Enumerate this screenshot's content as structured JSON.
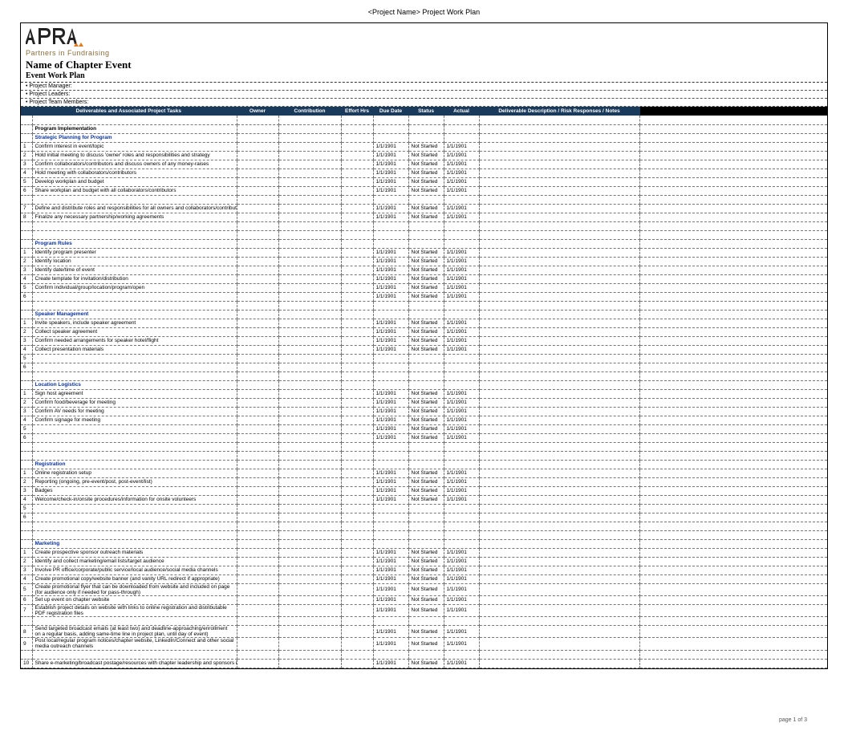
{
  "doc_header": "<Project Name>  Project Work Plan",
  "logo_tagline": "Partners in Fundraising",
  "title": "Name of Chapter Event",
  "subtitle": "Event Work Plan",
  "info": {
    "pm": "Project Manager:",
    "pl": "Project Leaders:",
    "ptm": "Project Team Members:"
  },
  "columns": {
    "task": "Deliverables and Associated Project Tasks",
    "owner": "Owner",
    "contrib": "Contribution",
    "effort": "Effort Hrs",
    "due": "Due Date",
    "status": "Status",
    "actual": "Actual",
    "desc": "Deliverable Description / Risk Responses / Notes"
  },
  "defaults": {
    "date": "1/1/1901",
    "status": "Not Started"
  },
  "sections": [
    {
      "label": "Program Implementation",
      "class": "sec-black",
      "rows": []
    },
    {
      "label": "Strategic Planning for Program",
      "class": "sec-blue",
      "rows": [
        {
          "n": "1",
          "task": "Confirm interest in event/topic",
          "std": true
        },
        {
          "n": "2",
          "task": "Hold initial meeting to discuss 'owner' roles and responsibilities and strategy",
          "std": true
        },
        {
          "n": "3",
          "task": "Confirm collaborators/contributors and discuss owners of any money-raises",
          "std": true
        },
        {
          "n": "4",
          "task": "Hold meeting with collaborators/contributors",
          "std": true
        },
        {
          "n": "5",
          "task": "Develop workplan and budget",
          "std": true
        },
        {
          "n": "6",
          "task": "Share workplan and budget with all collaborators/contributors",
          "std": true
        },
        {
          "n": "",
          "task": "",
          "std": false
        },
        {
          "n": "7",
          "task": "Define and distribute roles and responsibilities for all owners and collaborators/contributors",
          "std": true
        },
        {
          "n": "8",
          "task": "Finalize any necessary partnership/working agreements",
          "std": true
        },
        {
          "n": "",
          "task": "",
          "std": false
        },
        {
          "n": "",
          "task": "",
          "std": false
        }
      ]
    },
    {
      "label": "Program Rules",
      "class": "sec-blue",
      "rows": [
        {
          "n": "1",
          "task": "Identify program presenter",
          "std": true
        },
        {
          "n": "2",
          "task": "Identify location",
          "std": true
        },
        {
          "n": "3",
          "task": "Identify date/time of event",
          "std": true
        },
        {
          "n": "4",
          "task": "Create template for invitation/distribution",
          "std": true
        },
        {
          "n": "5",
          "task": "Confirm individual/group/location/program/open",
          "std": true
        },
        {
          "n": "6",
          "task": "",
          "std": true
        },
        {
          "n": "",
          "task": "",
          "std": false
        }
      ]
    },
    {
      "label": "Speaker Management",
      "class": "sec-blue",
      "rows": [
        {
          "n": "1",
          "task": "Invite speakers, include speaker agreement",
          "std": true
        },
        {
          "n": "2",
          "task": "Collect speaker agreement",
          "std": true
        },
        {
          "n": "3",
          "task": "Confirm needed arrangements for speaker hotel/flight",
          "std": true
        },
        {
          "n": "4",
          "task": "Collect presentation materials",
          "std": true
        },
        {
          "n": "5",
          "task": "",
          "std": false
        },
        {
          "n": "6",
          "task": "",
          "std": false
        },
        {
          "n": "",
          "task": "",
          "std": false
        }
      ]
    },
    {
      "label": "Location Logistics",
      "class": "sec-blue",
      "rows": [
        {
          "n": "1",
          "task": "Sign host agreement",
          "std": true
        },
        {
          "n": "2",
          "task": "Confirm food/beverage for meeting",
          "std": true
        },
        {
          "n": "3",
          "task": "Confirm AV needs for meeting",
          "std": true
        },
        {
          "n": "4",
          "task": "Confirm signage for meeting",
          "std": true
        },
        {
          "n": "5",
          "task": "",
          "std": true
        },
        {
          "n": "6",
          "task": "",
          "std": true
        },
        {
          "n": "",
          "task": "",
          "std": false
        },
        {
          "n": "",
          "task": "",
          "std": false
        }
      ]
    },
    {
      "label": "Registration",
      "class": "sec-blue",
      "rows": [
        {
          "n": "1",
          "task": "Online registration setup",
          "std": true
        },
        {
          "n": "2",
          "task": "Reporting (ongoing, pre-event/post, post-event/list)",
          "std": true
        },
        {
          "n": "3",
          "task": "Badges",
          "std": true
        },
        {
          "n": "4",
          "task": "Welcome/check-in/onsite procedures/information for onsite volunteers",
          "std": true
        },
        {
          "n": "5",
          "task": "",
          "std": false
        },
        {
          "n": "6",
          "task": "",
          "std": false
        },
        {
          "n": "",
          "task": "",
          "std": false
        },
        {
          "n": "",
          "task": "",
          "std": false
        }
      ]
    },
    {
      "label": "Marketing",
      "class": "sec-blue",
      "rows": [
        {
          "n": "1",
          "task": "Create prospective sponsor outreach materials",
          "std": true
        },
        {
          "n": "2",
          "task": "Identify and collect marketing/email lists/target audience",
          "std": true
        },
        {
          "n": "3",
          "task": "Involve PR office/corporate/public service/local audience/social media channels",
          "std": true
        },
        {
          "n": "4",
          "task": "Create promotional copy/website banner (and vanity URL redirect if appropriate)",
          "std": true
        },
        {
          "n": "5",
          "task": "Create promotional flyer that can be downloaded from website and included on page (for audience only if needed for pass-through)",
          "std": true,
          "wrap": true
        },
        {
          "n": "6",
          "task": "Set up event on chapter website",
          "std": true
        },
        {
          "n": "7",
          "task": "Establish project details on website with links to online registration and distributable PDF registration files",
          "std": true,
          "wrap": true
        },
        {
          "n": "",
          "task": "",
          "std": false
        },
        {
          "n": "8",
          "task": "Send targeted broadcast emails (at least two) and deadline-approaching/enrollment on a regular basis, adding same-time line in project plan, until day of event)",
          "std": true,
          "wrap": true
        },
        {
          "n": "9",
          "task": "Post local/regular program notices/chapter website, LinkedIn/Connect and other social media outreach channels",
          "std": true,
          "wrap": true
        },
        {
          "n": "",
          "task": "",
          "std": false
        },
        {
          "n": "10",
          "task": "Share e-marketing/broadcast postage/resources with chapter leadership and sponsors if appropriate",
          "std": true
        }
      ]
    }
  ],
  "footer": "page 1 of 3"
}
